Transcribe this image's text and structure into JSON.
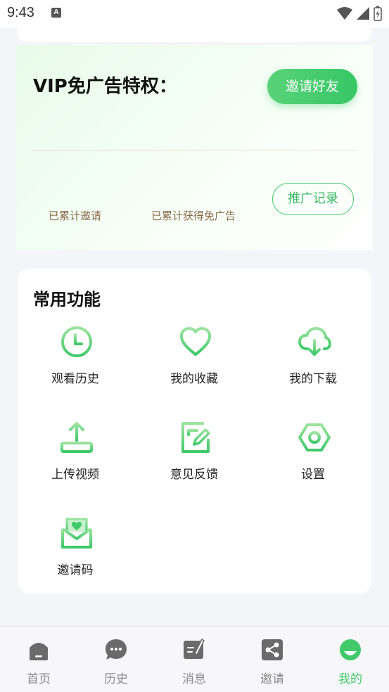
{
  "status": {
    "time": "9:43",
    "a_badge": "A"
  },
  "vip": {
    "title": "VIP免广告特权：",
    "invite_button": "邀请好友",
    "promo_button": "推广记录",
    "stat_invited_label": "已累计邀请",
    "stat_adfree_label": "已累计获得免广告"
  },
  "functions": {
    "title": "常用功能",
    "items": [
      {
        "label": "观看历史",
        "icon": "clock-icon"
      },
      {
        "label": "我的收藏",
        "icon": "heart-icon"
      },
      {
        "label": "我的下载",
        "icon": "cloud-download-icon"
      },
      {
        "label": "上传视频",
        "icon": "upload-icon"
      },
      {
        "label": "意见反馈",
        "icon": "edit-note-icon"
      },
      {
        "label": "设置",
        "icon": "settings-hex-icon"
      },
      {
        "label": "邀请码",
        "icon": "envelope-heart-icon"
      }
    ]
  },
  "tabbar": {
    "items": [
      {
        "label": "首页",
        "icon": "home-icon",
        "active": false
      },
      {
        "label": "历史",
        "icon": "chat-bubble-icon",
        "active": false
      },
      {
        "label": "消息",
        "icon": "note-pen-icon",
        "active": false
      },
      {
        "label": "邀请",
        "icon": "share-icon",
        "active": false
      },
      {
        "label": "我的",
        "icon": "profile-icon",
        "active": true
      }
    ]
  },
  "colors": {
    "accent": "#41c96a",
    "background": "#f4f5f9"
  }
}
